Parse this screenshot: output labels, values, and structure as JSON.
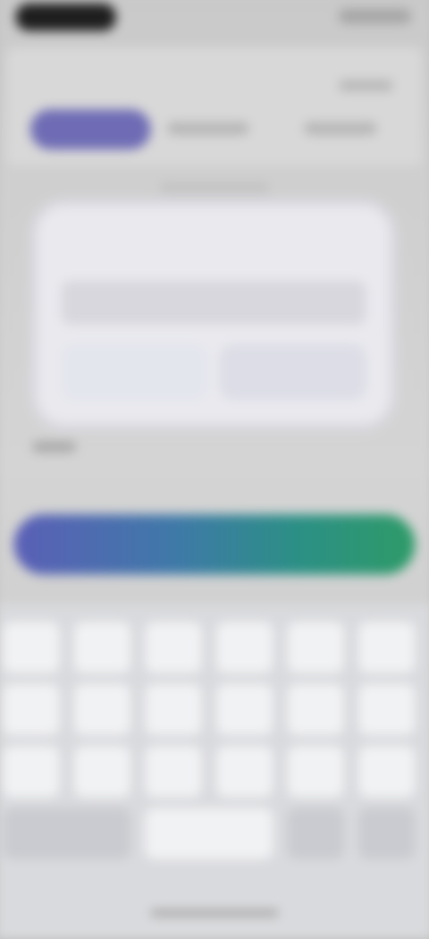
{
  "status_bar": {
    "time_pill": "",
    "indicators": ""
  },
  "header": {
    "top_right_link": "",
    "tabs": [
      {
        "label": ""
      },
      {
        "label": ""
      },
      {
        "label": ""
      }
    ],
    "hint": ""
  },
  "dialog": {
    "title": "",
    "input_value": "",
    "input_placeholder": "",
    "cancel_label": "",
    "confirm_label": ""
  },
  "form": {
    "small_label": ""
  },
  "action_bar": {
    "label": "",
    "colors": [
      "#5b5fb7",
      "#3f79a8",
      "#2c8f86",
      "#2e9b68"
    ]
  },
  "keyboard": {
    "rows": [
      [
        "",
        "",
        "",
        "",
        "",
        ""
      ],
      [
        "",
        "",
        "",
        "",
        "",
        ""
      ],
      [
        "",
        "",
        "",
        "",
        "",
        ""
      ],
      [
        "",
        "",
        "",
        "",
        "",
        ""
      ]
    ],
    "bottom": [
      "",
      "",
      "",
      ""
    ]
  },
  "accent_colors": {
    "tab_active": "#6f6cb5",
    "dialog_bg": "#e9e9ee"
  }
}
